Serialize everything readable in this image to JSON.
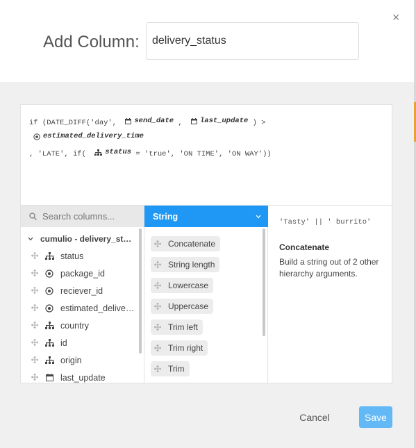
{
  "dialog": {
    "title": "Add Column:",
    "column_name_value": "delivery_status",
    "close_label": "×"
  },
  "formula": {
    "line1_prefix": "if (DATE_DIFF('day',",
    "token_send_date": "send_date",
    "sep1": ",",
    "token_last_update": "last_update",
    "sep2": ") >",
    "token_estimated": "estimated_delivery_time",
    "line2_prefix": ", 'LATE', if(",
    "token_status": "status",
    "line2_suffix": "= 'true', 'ON TIME', 'ON WAY'))"
  },
  "columns_panel": {
    "search_placeholder": "Search columns...",
    "dataset_label": "cumulio - delivery_stat...",
    "items": [
      {
        "label": "status",
        "type": "hierarchy-icon"
      },
      {
        "label": "package_id",
        "type": "numeric-icon"
      },
      {
        "label": "reciever_id",
        "type": "numeric-icon"
      },
      {
        "label": "estimated_delivery...",
        "type": "numeric-icon"
      },
      {
        "label": "country",
        "type": "hierarchy-icon"
      },
      {
        "label": "id",
        "type": "hierarchy-icon"
      },
      {
        "label": "origin",
        "type": "hierarchy-icon"
      },
      {
        "label": "last_update",
        "type": "calendar-icon"
      }
    ]
  },
  "functions_panel": {
    "category_label": "String",
    "items": [
      "Concatenate",
      "String length",
      "Lowercase",
      "Uppercase",
      "Trim left",
      "Trim right",
      "Trim"
    ]
  },
  "detail_panel": {
    "example": "'Tasty' || ' burrito'",
    "function_name": "Concatenate",
    "description": "Build a string out of 2 other hierarchy arguments."
  },
  "footer": {
    "cancel_label": "Cancel",
    "save_label": "Save"
  },
  "colors": {
    "accent": "#1e97f5",
    "save_button": "#63b8f6"
  }
}
